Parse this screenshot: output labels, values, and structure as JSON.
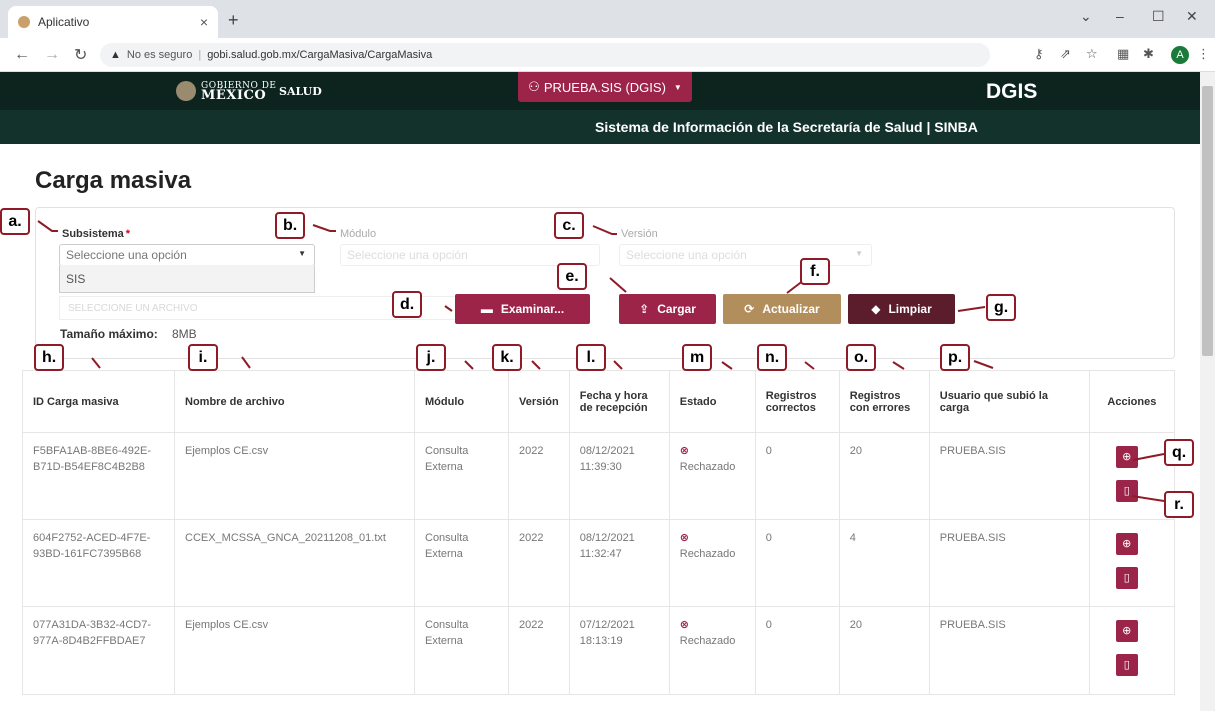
{
  "browser": {
    "tab_title": "Aplicativo",
    "tab_close": "×",
    "new_tab": "+",
    "insecure_label": "No es seguro",
    "url": "gobi.salud.gob.mx/CargaMasiva/CargaMasiva",
    "avatar_letter": "A"
  },
  "header": {
    "gobierno_small": "GOBIERNO DE",
    "gobierno_big": "MÉXICO",
    "salud": "SALUD",
    "user_menu": "PRUEBA.SIS (DGIS)",
    "dgis": "DGIS",
    "subtitle": "Sistema de Información de la Secretaría de Salud  |  SINBA"
  },
  "page": {
    "title": "Carga masiva"
  },
  "filters": {
    "subsistema_label": "Subsistema",
    "subsistema_placeholder": "Seleccione una opción",
    "subsistema_option": "SIS",
    "modulo_label": "Módulo",
    "modulo_placeholder": "Seleccione una opción",
    "version_label": "Versión",
    "version_placeholder": "Seleccione una opción",
    "file_placeholder": "SELECCIONE UN ARCHIVO",
    "size_label": "Tamaño máximo:",
    "size_value": "8MB"
  },
  "buttons": {
    "examinar": "Examinar...",
    "cargar": "Cargar",
    "actualizar": "Actualizar",
    "limpiar": "Limpiar"
  },
  "table": {
    "headers": {
      "id": "ID Carga masiva",
      "nombre": "Nombre de archivo",
      "modulo": "Módulo",
      "version": "Versión",
      "fecha": "Fecha y hora de recepción",
      "estado": "Estado",
      "correctos": "Registros correctos",
      "errores": "Registros con errores",
      "usuario": "Usuario que subió la carga",
      "acciones": "Acciones"
    },
    "rows": [
      {
        "id": "F5BFA1AB-8BE6-492E-B71D-B54EF8C4B2B8",
        "nombre": "Ejemplos CE.csv",
        "modulo": "Consulta Externa",
        "version": "2022",
        "fecha": "08/12/2021 11:39:30",
        "estado": "Rechazado",
        "correctos": "0",
        "errores": "20",
        "usuario": "PRUEBA.SIS"
      },
      {
        "id": "604F2752-ACED-4F7E-93BD-161FC7395B68",
        "nombre": "CCEX_MCSSA_GNCA_20211208_01.txt",
        "modulo": "Consulta Externa",
        "version": "2022",
        "fecha": "08/12/2021 11:32:47",
        "estado": "Rechazado",
        "correctos": "0",
        "errores": "4",
        "usuario": "PRUEBA.SIS"
      },
      {
        "id": "077A31DA-3B32-4CD7-977A-8D4B2FFBDAE7",
        "nombre": "Ejemplos CE.csv",
        "modulo": "Consulta Externa",
        "version": "2022",
        "fecha": "07/12/2021 18:13:19",
        "estado": "Rechazado",
        "correctos": "0",
        "errores": "20",
        "usuario": "PRUEBA.SIS"
      }
    ]
  },
  "callouts": {
    "a": "a.",
    "b": "b.",
    "c": "c.",
    "d": "d.",
    "e": "e.",
    "f": "f.",
    "g": "g.",
    "h": "h.",
    "i": "i.",
    "j": "j.",
    "k": "k.",
    "l": "l.",
    "m": "m",
    "n": "n.",
    "o": "o.",
    "p": "p.",
    "q": "q.",
    "r": "r."
  },
  "colors": {
    "guinda": "#9d2449",
    "dorado": "#b38e5d",
    "vino": "#5b1d2c",
    "header_dark": "#0c231e",
    "subheader": "#13322b",
    "callout_border": "#8e1b26"
  },
  "icons": [
    "folder-icon",
    "upload-icon",
    "refresh-icon",
    "eraser-icon",
    "zoom-icon",
    "trash-icon",
    "reject-icon",
    "user-icon",
    "warning-icon"
  ]
}
